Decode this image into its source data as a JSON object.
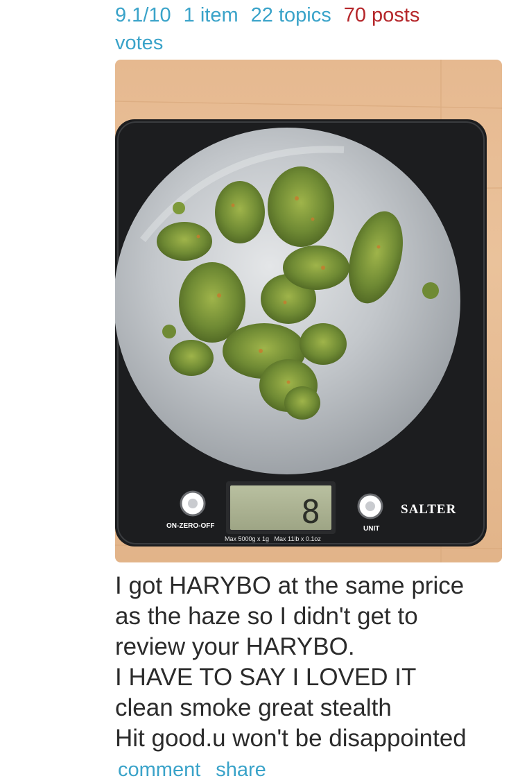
{
  "stats": {
    "rating": "9.1/10",
    "items": "1 item",
    "topics": "22 topics",
    "posts": "70 posts",
    "votes": "votes"
  },
  "photo": {
    "brand": "SALTER",
    "power_label": "ON-ZERO-OFF",
    "unit_label": "UNIT",
    "capacity_label": "Max 5000g x 1g   Max 11lb x 0.1oz",
    "display_reading": "8"
  },
  "review": {
    "lines": [
      "I got HARYBO at the same price",
      "as the haze so I didn't get to",
      "review your HARYBO.",
      "I HAVE TO SAY I LOVED IT",
      "clean smoke great stealth",
      "Hit good.u won't be disappointed"
    ]
  },
  "actions": {
    "comment": "comment",
    "share": "share"
  },
  "colors": {
    "link": "#3aa3c9",
    "posts": "#b5262a",
    "text": "#2b2b2b"
  }
}
